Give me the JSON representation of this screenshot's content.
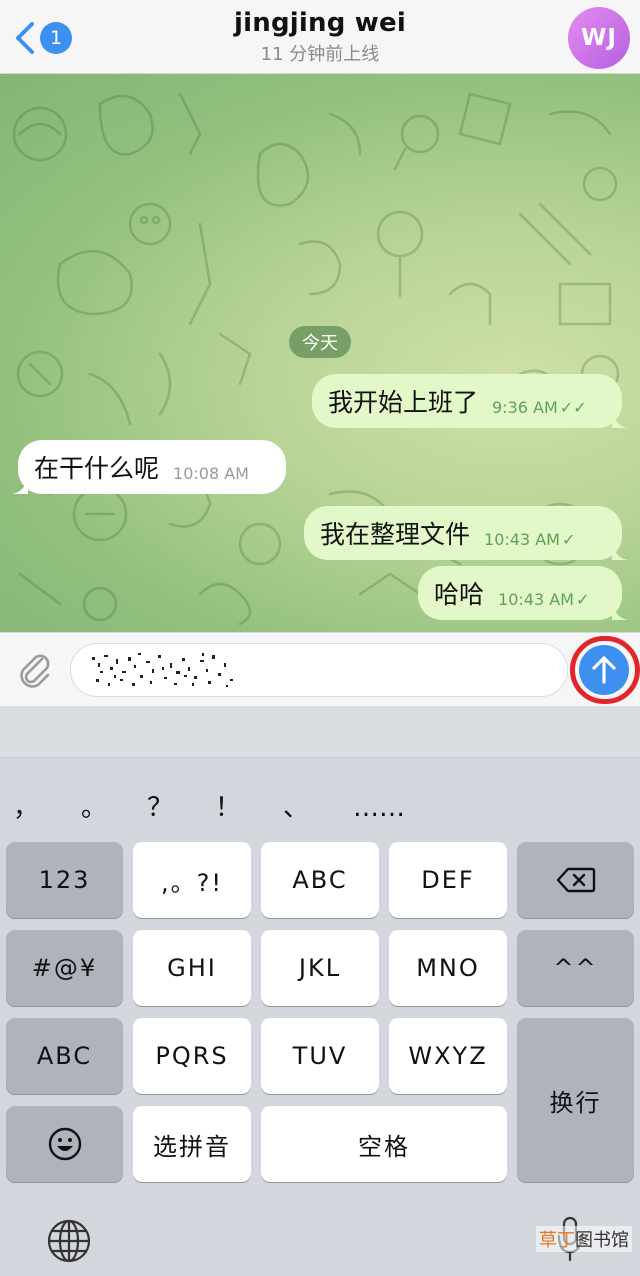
{
  "header": {
    "back_badge": "1",
    "title": "jingjing wei",
    "subtitle": "11 分钟前上线",
    "avatar_initials": "WJ"
  },
  "chat": {
    "date_label": "今天",
    "messages": [
      {
        "direction": "out",
        "text": "我开始上班了",
        "time": "9:36 AM",
        "status": "read"
      },
      {
        "direction": "in",
        "text": "在干什么呢",
        "time": "10:08 AM"
      },
      {
        "direction": "out",
        "text": "我在整理文件",
        "time": "10:43 AM",
        "status": "sent"
      },
      {
        "direction": "out",
        "text": "哈哈",
        "time": "10:43 AM",
        "status": "sent"
      }
    ]
  },
  "input": {
    "value_obscured": true
  },
  "keyboard": {
    "punctuation": [
      "，",
      "。",
      "？",
      "！",
      "、",
      "……"
    ],
    "rows": [
      [
        "123",
        ",。?!",
        "ABC",
        "DEF",
        "delete"
      ],
      [
        "#@¥",
        "GHI",
        "JKL",
        "MNO",
        "^^"
      ],
      [
        "ABC",
        "PQRS",
        "TUV",
        "WXYZ",
        "换行"
      ],
      [
        "emoji",
        "选拼音",
        "空格"
      ]
    ]
  },
  "watermark": {
    "accent": "草丁",
    "rest": "图书馆"
  },
  "colors": {
    "accent_blue": "#3d8ff0",
    "outgoing_bubble": "#e3f8c8",
    "time_green": "#5fa352",
    "send_highlight": "#e2242c"
  }
}
